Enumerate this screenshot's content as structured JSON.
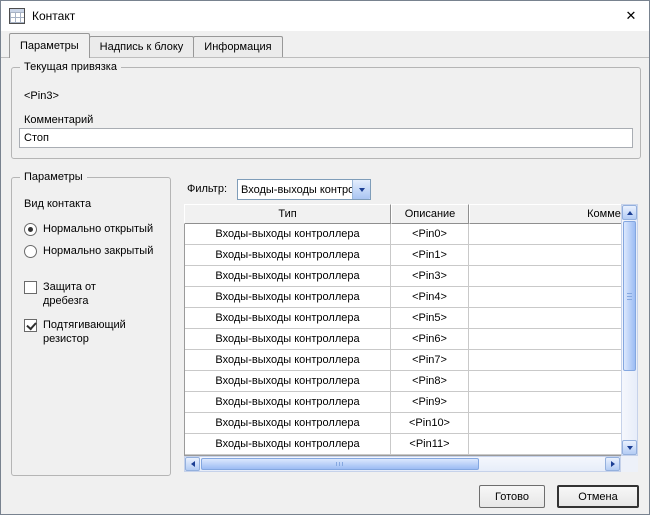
{
  "window": {
    "title": "Контакт",
    "close_glyph": "✕"
  },
  "tabs": [
    {
      "label": "Параметры",
      "active": true
    },
    {
      "label": "Надпись к блоку",
      "active": false
    },
    {
      "label": "Информация",
      "active": false
    }
  ],
  "binding": {
    "group_title": "Текущая привязка",
    "pin_value": "<Pin3>",
    "comment_label": "Комментарий",
    "comment_value": "Стоп"
  },
  "parameters": {
    "group_title": "Параметры",
    "kind_label": "Вид контакта",
    "radio_open": {
      "label": "Нормально открытый",
      "checked": true
    },
    "radio_closed": {
      "label": "Нормально закрытый",
      "checked": false
    },
    "check_debounce": {
      "label": "Защита от дребезга",
      "checked": false
    },
    "check_pullup": {
      "label": "Подтягивающий резистор",
      "checked": true
    }
  },
  "filter": {
    "label": "Фильтр:",
    "value": "Входы-выходы контроллера"
  },
  "table": {
    "columns": [
      "Тип",
      "Описание",
      "Комме"
    ],
    "rows": [
      {
        "type": "Входы-выходы контроллера",
        "desc": "<Pin0>",
        "comment": ""
      },
      {
        "type": "Входы-выходы контроллера",
        "desc": "<Pin1>",
        "comment": ""
      },
      {
        "type": "Входы-выходы контроллера",
        "desc": "<Pin3>",
        "comment": ""
      },
      {
        "type": "Входы-выходы контроллера",
        "desc": "<Pin4>",
        "comment": ""
      },
      {
        "type": "Входы-выходы контроллера",
        "desc": "<Pin5>",
        "comment": ""
      },
      {
        "type": "Входы-выходы контроллера",
        "desc": "<Pin6>",
        "comment": ""
      },
      {
        "type": "Входы-выходы контроллера",
        "desc": "<Pin7>",
        "comment": ""
      },
      {
        "type": "Входы-выходы контроллера",
        "desc": "<Pin8>",
        "comment": ""
      },
      {
        "type": "Входы-выходы контроллера",
        "desc": "<Pin9>",
        "comment": ""
      },
      {
        "type": "Входы-выходы контроллера",
        "desc": "<Pin10>",
        "comment": ""
      },
      {
        "type": "Входы-выходы контроллера",
        "desc": "<Pin11>",
        "comment": ""
      }
    ]
  },
  "footer": {
    "done_label": "Готово",
    "cancel_label": "Отмена"
  },
  "colors": {
    "dialog_bg": "#f0f0f0",
    "titlebar_bg": "#ffffff",
    "scrollbar_thumb": "#9cbcf4",
    "scrollbar_track": "#eef2fa",
    "combo_border": "#7f9db9"
  }
}
